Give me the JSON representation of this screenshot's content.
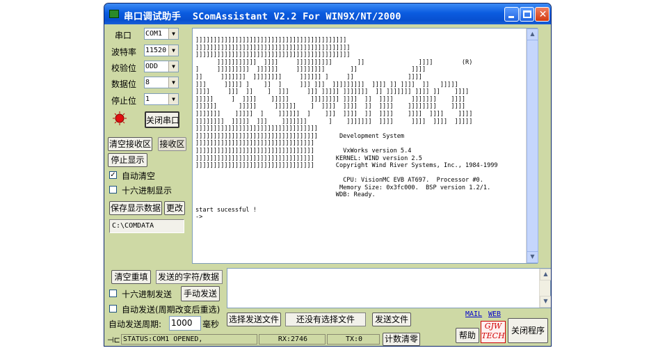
{
  "window": {
    "title": "串口调试助手  SComAssistant V2.2 For WIN9X/NT/2000",
    "minimize_glyph": "—",
    "maximize_glyph": "□",
    "close_glyph": "✕"
  },
  "settings": {
    "port_label": "串口",
    "port_value": "COM1",
    "baud_label": "波特率",
    "baud_value": "11520",
    "parity_label": "校验位",
    "parity_value": "ODD",
    "databits_label": "数据位",
    "databits_value": "8",
    "stopbits_label": "停止位",
    "stopbits_value": "1",
    "close_port_button": "关闭串口",
    "led_color": "#e01010"
  },
  "receive": {
    "clear_button": "清空接收区",
    "area_label": "接收区",
    "stop_display_button": "停止显示",
    "auto_clear_label": "自动清空",
    "auto_clear_checked": "✓",
    "hex_display_label": "十六进制显示",
    "save_button": "保存显示数据",
    "change_button": "更改",
    "save_path": "C:\\COMDATA",
    "terminal_text": "]]]]]]]]]]]]]]]]]]]]]]]]]]]]]]]]]]]]]]]]]]\n]]]]]]]]]]]]]]]]]]]]]]]]]]]]]]]]]]]]]]]]]]]\n]]]]]]]]]]]]]]]]]]]]]]]]]]]]]]]]]]]]]]]]]]]\n      ]]]]]]]]]]]  ]]]]     ]]]]]]]]]]       ]]               ]]]]        (R)\n]     ]]]]]]]]]  ]]]]]]     ]]]]]]]]       ]]               ]]]]\n]]     ]]]]]]]  ]]]]]]]]     ]]]]]] ]     ]]               ]]]]\n]]]     ]]]]] ]    ]]  ]     ]]] ]]]  ]]]]]]]]]  ]]]] ]] ]]]]  ]]   ]]]]]\n]]]]     ]]]  ]]    ]  ]]]     ]]] ]]]]] ]]]]]]]  ]] ]]]]]]] ]]]] ]]    ]]]]\n]]]]]     ]  ]]]]    ]]]]]      ]]]]]]]] ]]]]  ]]  ]]]]     ]]]]]]]    ]]]]\n]]]]]]      ]]]]]     ]]]]]]    ]  ]]]]  ]]]]  ]]  ]]]]    ]]]]]]]]    ]]]]\n]]]]]]]    ]]]]]  ]    ]]]]]]  ]    ]]]  ]]]]  ]]  ]]]]    ]]]]  ]]]]    ]]]]\n]]]]]]]]  ]]]]]  ]]]    ]]]]]]]      ]    ]]]]]]]  ]]]]     ]]]]  ]]]]  ]]]]]\n]]]]]]]]]]]]]]]]]]]]]]]]]]]]]]]]]]\n]]]]]]]]]]]]]]]]]]]]]]]]]]]]]]]]]]      Development System\n]]]]]]]]]]]]]]]]]]]]]]]]]]]]]]]]]\n]]]]]]]]]]]]]]]]]]]]]]]]]]]]]]]]]        VxWorks version 5.4\n]]]]]]]]]]]]]]]]]]]]]]]]]]]]]]]]]      KERNEL: WIND version 2.5\n]]]]]]]]]]]]]]]]]]]]]]]]]]]]]]]]]      Copyright Wind River Systems, Inc., 1984-1999\n\n                                         CPU: VisionMC EVB AT697.  Processor #0.\n                                        Memory Size: 0x3fc000.  BSP version 1.2/1.\n                                       WDB: Ready.\n\nstart sucessful !\n->"
  },
  "send": {
    "clear_resend_button": "清空重填",
    "sent_chars_label": "发送的字符/数据",
    "hex_send_label": "十六进制发送",
    "manual_send_button": "手动发送",
    "auto_send_label": "自动发送(周期改变后重选)",
    "period_label": "自动发送周期:",
    "period_value": "1000",
    "period_unit": "毫秒",
    "select_file_button": "选择发送文件",
    "no_file_label": "还没有选择文件",
    "send_file_button": "发送文件",
    "mail_link": "MAIL",
    "web_link": "WEB",
    "help_button": "帮助",
    "logo_line1": "GJW",
    "logo_line2": "TECH",
    "close_program_button": "关闭程序"
  },
  "statusbar": {
    "status_text": "STATUS:COM1 OPENED,",
    "rx_text": "RX:2746",
    "tx_text": "TX:0",
    "reset_count_button": "计数清零"
  },
  "colors": {
    "panel_bg": "#ced9a5",
    "titlebar_blue": "#0b5ce0"
  }
}
